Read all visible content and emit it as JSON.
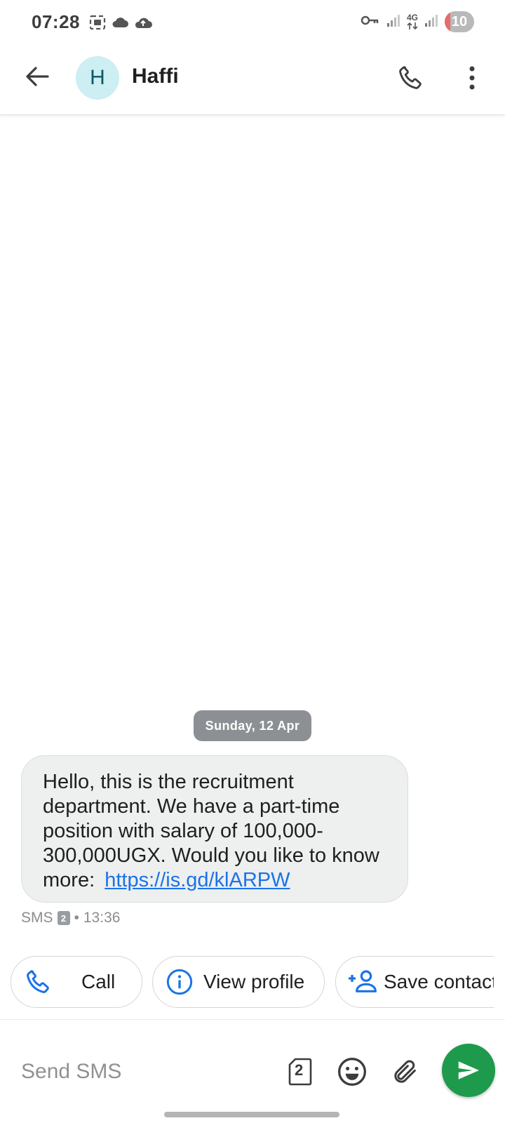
{
  "status_bar": {
    "time": "07:28",
    "network_label": "4G",
    "battery": "10",
    "left_icons": [
      "screenshot-icon",
      "cloud-icon",
      "cloud-upload-icon"
    ],
    "right_icons": [
      "vpn-key-icon",
      "signal-icon",
      "data-4g-icon",
      "signal-icon",
      "battery-icon"
    ]
  },
  "header": {
    "avatar_letter": "H",
    "contact_name": "Haffi",
    "avatar_color": "#cdeef2"
  },
  "conversation": {
    "date_label": "Sunday, 12 Apr",
    "message": {
      "text": "Hello, this is the recruitment department. We have a part-time position with salary of 100,000-300,000UGX. Would you like to know more:",
      "link": "https://is.gd/klARPW",
      "channel": "SMS",
      "sim": "2",
      "separator": "•",
      "time": "13:36"
    }
  },
  "suggestions": [
    {
      "label": "Call",
      "icon": "phone-icon"
    },
    {
      "label": "View profile",
      "icon": "info-icon"
    },
    {
      "label": "Save contact",
      "icon": "add-person-icon"
    }
  ],
  "compose": {
    "placeholder": "Send SMS",
    "sim_label": "2",
    "send_color": "#1e9a4c"
  },
  "colors": {
    "accent": "#1a73e8",
    "send": "#1e9a4c",
    "bubble": "#eeefef",
    "date_chip": "#8c8f93"
  }
}
